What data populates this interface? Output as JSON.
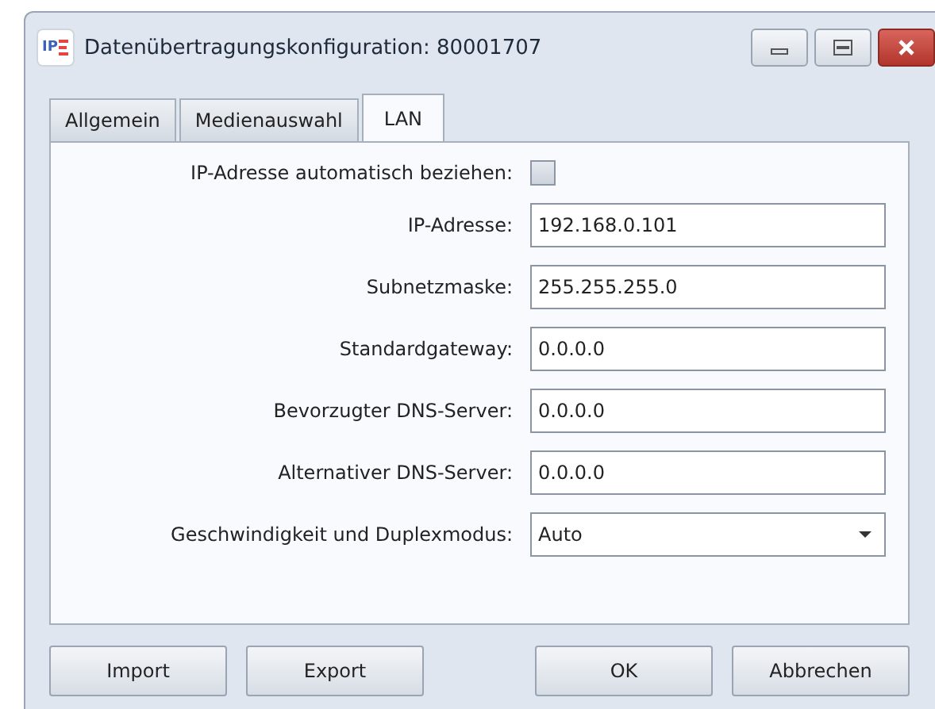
{
  "window": {
    "title": "Datenübertragungskonfiguration: 80001707",
    "app_icon_text": "IP"
  },
  "tabs": [
    {
      "label": "Allgemein",
      "selected": false
    },
    {
      "label": "Medienauswahl",
      "selected": false
    },
    {
      "label": "LAN",
      "selected": true
    }
  ],
  "auto_ip": {
    "label": "IP-Adresse automatisch beziehen:",
    "checked": false
  },
  "fields": [
    {
      "kind": "text",
      "label": "IP-Adresse:",
      "value": "192.168.0.101"
    },
    {
      "kind": "text",
      "label": "Subnetzmaske:",
      "value": "255.255.255.0"
    },
    {
      "kind": "text",
      "label": "Standardgateway:",
      "value": "0.0.0.0"
    },
    {
      "kind": "text",
      "label": "Bevorzugter DNS-Server:",
      "value": "0.0.0.0"
    },
    {
      "kind": "text",
      "label": "Alternativer DNS-Server:",
      "value": "0.0.0.0"
    },
    {
      "kind": "dropdown",
      "label": "Geschwindigkeit und Duplexmodus:",
      "value": "Auto"
    }
  ],
  "buttons_left": [
    "Import",
    "Export"
  ],
  "buttons_right": [
    "OK",
    "Abbrechen"
  ]
}
